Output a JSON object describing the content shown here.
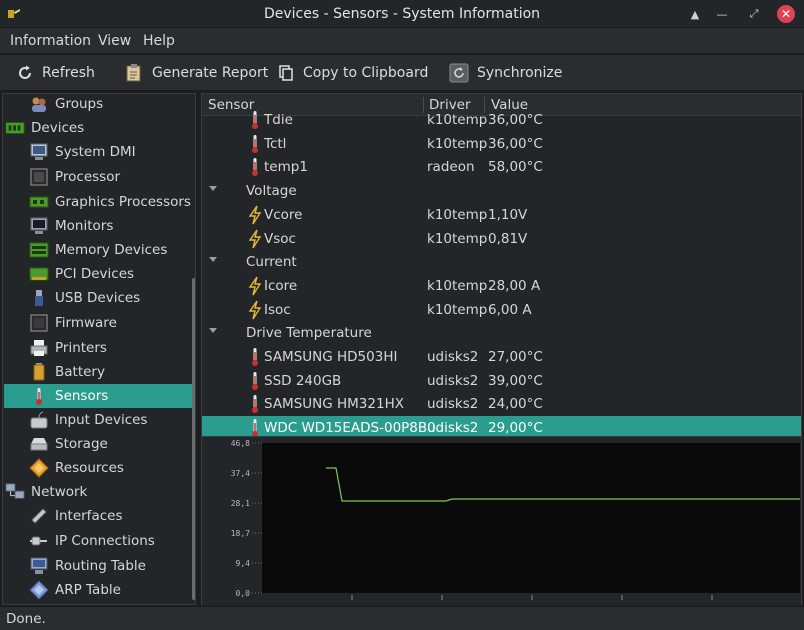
{
  "window": {
    "title": "Devices - Sensors - System Information",
    "close_glyph": "✕",
    "min_glyph": "—",
    "max_glyph": "⤢",
    "shade_glyph": "▲"
  },
  "menu": {
    "items": [
      "Information",
      "View",
      "Help"
    ]
  },
  "toolbar": {
    "refresh": "Refresh",
    "generate_report": "Generate Report",
    "copy_to_clipboard": "Copy to Clipboard",
    "synchronize": "Synchronize"
  },
  "sidebar": {
    "items": [
      {
        "label": "Groups",
        "icon": "groups-icon"
      },
      {
        "label": "Devices",
        "icon": "devices-icon"
      },
      {
        "label": "System DMI",
        "icon": "monitor-icon"
      },
      {
        "label": "Processor",
        "icon": "chip-icon"
      },
      {
        "label": "Graphics Processors",
        "icon": "gpu-icon"
      },
      {
        "label": "Monitors",
        "icon": "monitor-icon"
      },
      {
        "label": "Memory Devices",
        "icon": "memory-icon"
      },
      {
        "label": "PCI Devices",
        "icon": "pci-icon"
      },
      {
        "label": "USB Devices",
        "icon": "usb-icon"
      },
      {
        "label": "Firmware",
        "icon": "chip-icon"
      },
      {
        "label": "Printers",
        "icon": "printer-icon"
      },
      {
        "label": "Battery",
        "icon": "battery-icon"
      },
      {
        "label": "Sensors",
        "icon": "thermometer-icon"
      },
      {
        "label": "Input Devices",
        "icon": "input-icon"
      },
      {
        "label": "Storage",
        "icon": "storage-icon"
      },
      {
        "label": "Resources",
        "icon": "resources-icon"
      },
      {
        "label": "Network",
        "icon": "network-icon"
      },
      {
        "label": "Interfaces",
        "icon": "interfaces-icon"
      },
      {
        "label": "IP Connections",
        "icon": "ip-icon"
      },
      {
        "label": "Routing Table",
        "icon": "routing-icon"
      },
      {
        "label": "ARP Table",
        "icon": "arp-icon"
      }
    ],
    "selected": "Sensors"
  },
  "table": {
    "headers": {
      "sensor": "Sensor",
      "driver": "Driver",
      "value": "Value"
    },
    "rows": [
      {
        "kind": "item",
        "icon": "thermometer-icon",
        "sensor": "Tdie",
        "driver": "k10temp",
        "value": "36,00°C"
      },
      {
        "kind": "item",
        "icon": "thermometer-icon",
        "sensor": "Tctl",
        "driver": "k10temp",
        "value": "36,00°C"
      },
      {
        "kind": "item",
        "icon": "thermometer-icon",
        "sensor": "temp1",
        "driver": "radeon",
        "value": "58,00°C"
      },
      {
        "kind": "group",
        "sensor": "Voltage"
      },
      {
        "kind": "item",
        "icon": "bolt-icon",
        "sensor": "Vcore",
        "driver": "k10temp",
        "value": "1,10V"
      },
      {
        "kind": "item",
        "icon": "bolt-icon",
        "sensor": "Vsoc",
        "driver": "k10temp",
        "value": "0,81V"
      },
      {
        "kind": "group",
        "sensor": "Current"
      },
      {
        "kind": "item",
        "icon": "bolt-icon",
        "sensor": "Icore",
        "driver": "k10temp",
        "value": "28,00 A"
      },
      {
        "kind": "item",
        "icon": "bolt-icon",
        "sensor": "Isoc",
        "driver": "k10temp",
        "value": "6,00 A"
      },
      {
        "kind": "group",
        "sensor": "Drive Temperature"
      },
      {
        "kind": "item",
        "icon": "thermometer-icon",
        "sensor": "SAMSUNG HD503HI",
        "driver": "udisks2",
        "value": "27,00°C"
      },
      {
        "kind": "item",
        "icon": "thermometer-icon",
        "sensor": "SSD 240GB",
        "driver": "udisks2",
        "value": "39,00°C"
      },
      {
        "kind": "item",
        "icon": "thermometer-icon",
        "sensor": "SAMSUNG HM321HX",
        "driver": "udisks2",
        "value": "24,00°C"
      },
      {
        "kind": "item",
        "icon": "thermometer-icon",
        "sensor": "WDC WD15EADS-00P8B0",
        "driver": "udisks2",
        "value": "29,00°C",
        "selected": true
      }
    ]
  },
  "graph": {
    "y_ticks": [
      "46,8",
      "37,4",
      "28,1",
      "18,7",
      "9,4",
      "0,0"
    ],
    "line_color": "#7ec850",
    "background": "#0a0a0a"
  },
  "status": {
    "text": "Done."
  },
  "colors": {
    "accent": "#2a9d8f"
  }
}
